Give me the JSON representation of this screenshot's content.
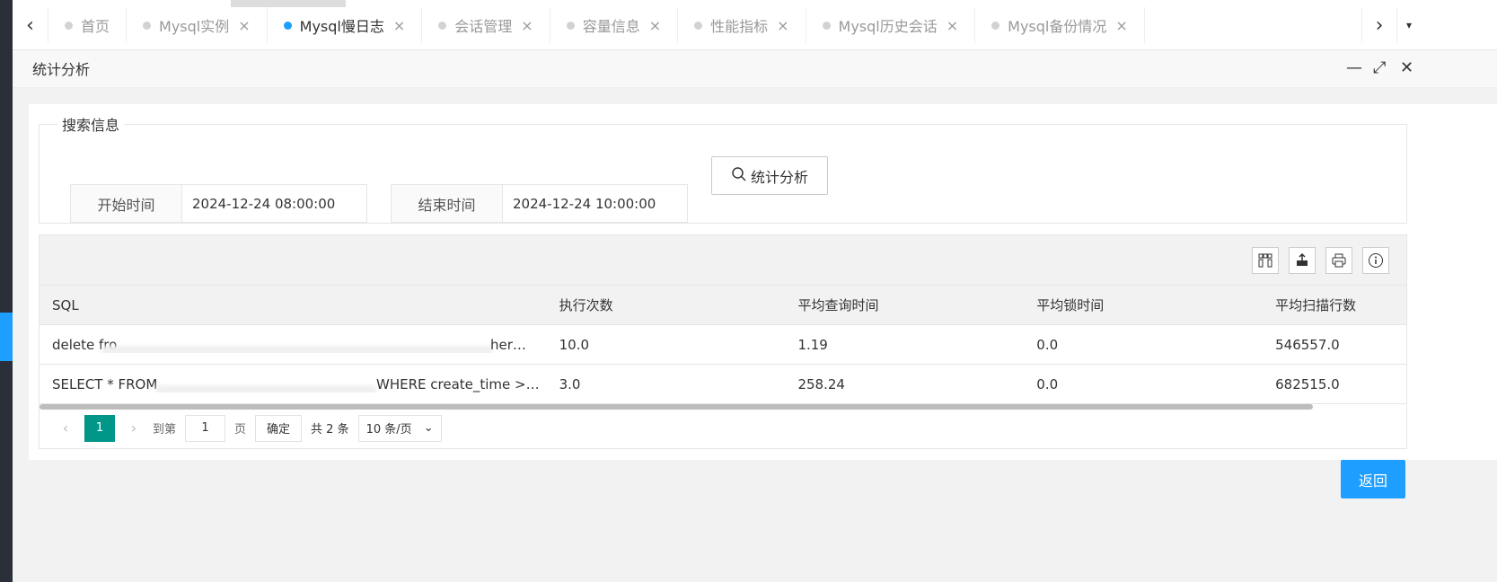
{
  "tabs": [
    {
      "label": "首页",
      "closable": false,
      "active": false
    },
    {
      "label": "Mysql实例",
      "closable": true,
      "active": false
    },
    {
      "label": "Mysql慢日志",
      "closable": true,
      "active": true
    },
    {
      "label": "会话管理",
      "closable": true,
      "active": false
    },
    {
      "label": "容量信息",
      "closable": true,
      "active": false
    },
    {
      "label": "性能指标",
      "closable": true,
      "active": false
    },
    {
      "label": "Mysql历史会话",
      "closable": true,
      "active": false
    },
    {
      "label": "Mysql备份情况",
      "closable": true,
      "active": false
    }
  ],
  "panel": {
    "title": "统计分析"
  },
  "search": {
    "legend": "搜索信息",
    "start_label": "开始时间",
    "start_value": "2024-12-24 08:00:00",
    "end_label": "结束时间",
    "end_value": "2024-12-24 10:00:00",
    "button_label": "统计分析"
  },
  "table": {
    "columns": [
      "SQL",
      "执行次数",
      "平均查询时间",
      "平均锁时间",
      "平均扫描行数"
    ],
    "rows": [
      {
        "sql_start": "delete fro",
        "sql_end": "her…",
        "count": "10.0",
        "avg_query": "1.19",
        "avg_lock": "0.0",
        "avg_rows": "546557.0"
      },
      {
        "sql_start": "SELECT * FROM",
        "sql_end": "WHERE create_time >…",
        "count": "3.0",
        "avg_query": "258.24",
        "avg_lock": "0.0",
        "avg_rows": "682515.0"
      }
    ]
  },
  "pager": {
    "current": "1",
    "goto_label": "到第",
    "goto_value": "1",
    "page_unit": "页",
    "ok_label": "确定",
    "total": "共 2 条",
    "size": "10 条/页"
  },
  "back_label": "返回",
  "colors": {
    "accent": "#1e9fff",
    "pager_active": "#009688"
  }
}
